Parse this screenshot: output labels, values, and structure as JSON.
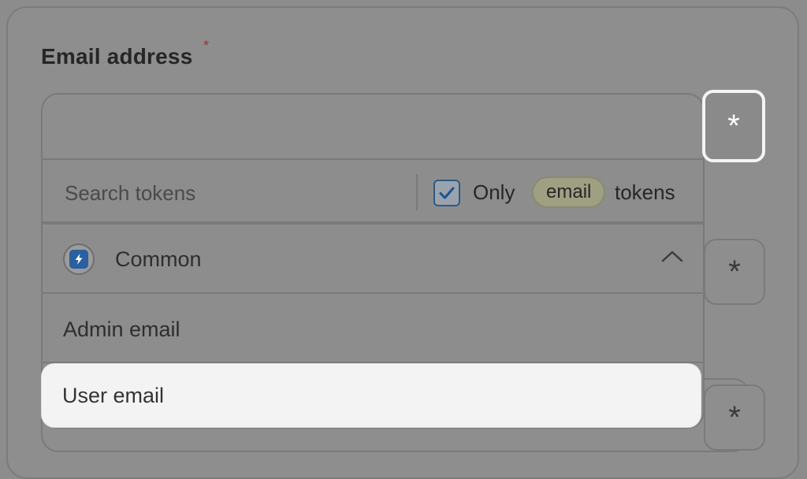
{
  "field": {
    "label": "Email address",
    "required_mark": "*"
  },
  "token_button": {
    "glyph": "*"
  },
  "dropdown": {
    "search_placeholder": "Search tokens",
    "only_label": "Only",
    "filter_pill": "email",
    "tokens_label": "tokens",
    "only_checked": true,
    "group": {
      "label": "Common",
      "icon": "lightning-icon",
      "expanded": true
    },
    "items": [
      {
        "label": "Admin email"
      },
      {
        "label": "User email",
        "highlighted": true
      }
    ]
  },
  "colors": {
    "highlight": "#f3f3f3",
    "checkbox": "#2d5a87",
    "pill": "#9f9f82",
    "required": "#8b3a3a"
  }
}
